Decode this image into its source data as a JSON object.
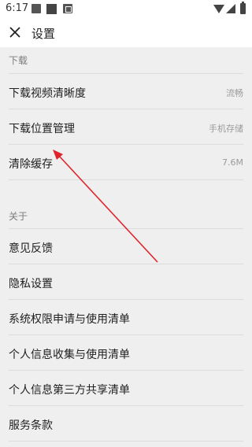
{
  "status_bar": {
    "time": "6:17"
  },
  "header": {
    "title": "设置"
  },
  "sections": {
    "download": {
      "header": "下载",
      "items": [
        {
          "label": "下载视频清晰度",
          "value": "流畅"
        },
        {
          "label": "下载位置管理",
          "value": "手机存储"
        },
        {
          "label": "清除缓存",
          "value": "7.6M"
        }
      ]
    },
    "about": {
      "header": "关于",
      "items": [
        {
          "label": "意见反馈"
        },
        {
          "label": "隐私设置"
        },
        {
          "label": "系统权限申请与使用清单"
        },
        {
          "label": "个人信息收集与使用清单"
        },
        {
          "label": "个人信息第三方共享清单"
        },
        {
          "label": "服务条款"
        }
      ]
    }
  },
  "colors": {
    "annotation_arrow": "#e0242b",
    "background": "#efefef",
    "bars": "#ffffff"
  },
  "icons": [
    "image-icon",
    "square-icon",
    "a-icon",
    "wifi-icon",
    "signal-icon",
    "battery-icon",
    "close-icon"
  ]
}
